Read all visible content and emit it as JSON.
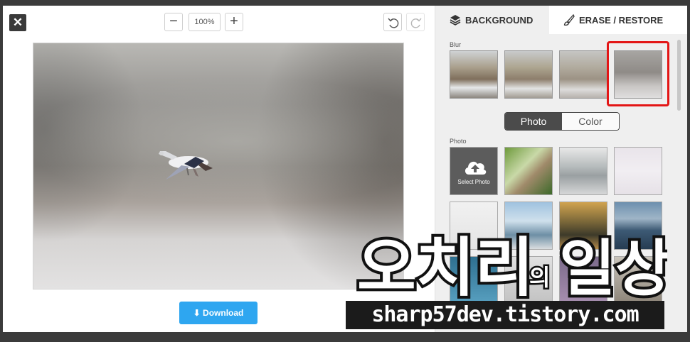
{
  "editor": {
    "zoom_level": "100%",
    "download_label": "Download"
  },
  "panel": {
    "tabs": [
      {
        "label": "BACKGROUND",
        "icon": "layers-icon",
        "active": false
      },
      {
        "label": "ERASE / RESTORE",
        "icon": "brush-icon",
        "active": true
      }
    ],
    "blur_section_label": "Blur",
    "blur_selected_index": 3,
    "blur_levels": 4,
    "toggle": {
      "photo_label": "Photo",
      "color_label": "Color",
      "selected": "Photo"
    },
    "photo_section_label": "Photo",
    "select_photo_label": "Select Photo"
  },
  "watermark": {
    "title_big1": "오치리",
    "title_small": "의",
    "title_big2": "일상",
    "url": "sharp57dev.tistory.com"
  },
  "colors": {
    "accent_blue": "#2ea6f0",
    "selection_red": "#e31616",
    "panel_bg": "#efefef",
    "page_bg": "#3b3b3b"
  }
}
